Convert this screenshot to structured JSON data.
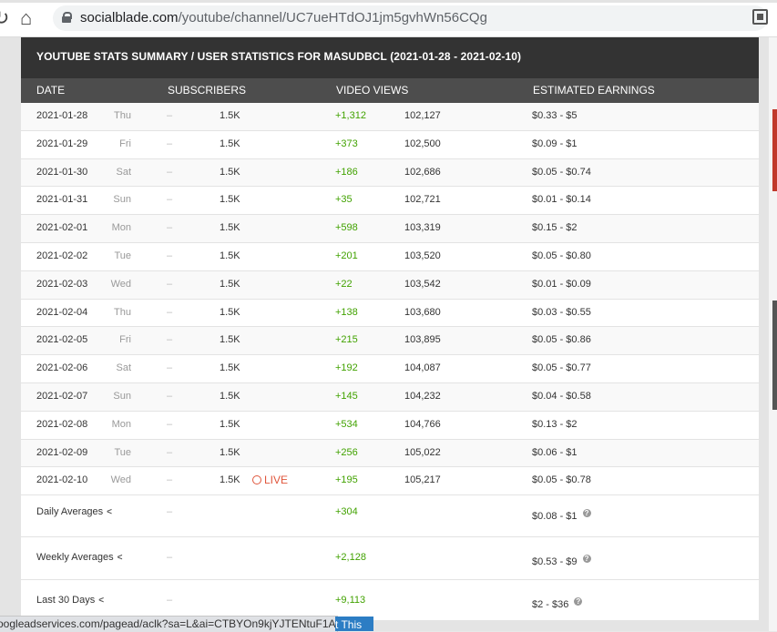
{
  "browser": {
    "url_host": "socialblade.com",
    "url_path": "/youtube/channel/UC7ueHTdOJ1jm5gvhWn56CQg",
    "status_url": "oogleadservices.com/pagead/aclk?sa=L&ai=CTBYOn9kjYJTENtuF1A...",
    "overlay_button": "t This"
  },
  "panel": {
    "title": "YOUTUBE STATS SUMMARY / USER STATISTICS FOR MASUDBCL (2021-01-28 - 2021-02-10)",
    "columns": {
      "date": "DATE",
      "subscribers": "SUBSCRIBERS",
      "video_views": "VIDEO VIEWS",
      "earnings": "ESTIMATED EARNINGS"
    },
    "rows": [
      {
        "date": "2021-01-28",
        "dow": "Thu",
        "dash": "–",
        "subs": "1.5K",
        "views_delta": "+1,312",
        "views": "102,127",
        "earnings": "$0.33  -  $5"
      },
      {
        "date": "2021-01-29",
        "dow": "Fri",
        "dash": "–",
        "subs": "1.5K",
        "views_delta": "+373",
        "views": "102,500",
        "earnings": "$0.09  -  $1"
      },
      {
        "date": "2021-01-30",
        "dow": "Sat",
        "dash": "–",
        "subs": "1.5K",
        "views_delta": "+186",
        "views": "102,686",
        "earnings": "$0.05  -  $0.74"
      },
      {
        "date": "2021-01-31",
        "dow": "Sun",
        "dash": "–",
        "subs": "1.5K",
        "views_delta": "+35",
        "views": "102,721",
        "earnings": "$0.01  -  $0.14"
      },
      {
        "date": "2021-02-01",
        "dow": "Mon",
        "dash": "–",
        "subs": "1.5K",
        "views_delta": "+598",
        "views": "103,319",
        "earnings": "$0.15  -  $2"
      },
      {
        "date": "2021-02-02",
        "dow": "Tue",
        "dash": "–",
        "subs": "1.5K",
        "views_delta": "+201",
        "views": "103,520",
        "earnings": "$0.05  -  $0.80"
      },
      {
        "date": "2021-02-03",
        "dow": "Wed",
        "dash": "–",
        "subs": "1.5K",
        "views_delta": "+22",
        "views": "103,542",
        "earnings": "$0.01  -  $0.09"
      },
      {
        "date": "2021-02-04",
        "dow": "Thu",
        "dash": "–",
        "subs": "1.5K",
        "views_delta": "+138",
        "views": "103,680",
        "earnings": "$0.03  -  $0.55"
      },
      {
        "date": "2021-02-05",
        "dow": "Fri",
        "dash": "–",
        "subs": "1.5K",
        "views_delta": "+215",
        "views": "103,895",
        "earnings": "$0.05  -  $0.86"
      },
      {
        "date": "2021-02-06",
        "dow": "Sat",
        "dash": "–",
        "subs": "1.5K",
        "views_delta": "+192",
        "views": "104,087",
        "earnings": "$0.05  -  $0.77"
      },
      {
        "date": "2021-02-07",
        "dow": "Sun",
        "dash": "–",
        "subs": "1.5K",
        "views_delta": "+145",
        "views": "104,232",
        "earnings": "$0.04  -  $0.58"
      },
      {
        "date": "2021-02-08",
        "dow": "Mon",
        "dash": "–",
        "subs": "1.5K",
        "views_delta": "+534",
        "views": "104,766",
        "earnings": "$0.13  -  $2"
      },
      {
        "date": "2021-02-09",
        "dow": "Tue",
        "dash": "–",
        "subs": "1.5K",
        "views_delta": "+256",
        "views": "105,022",
        "earnings": "$0.06  -  $1"
      },
      {
        "date": "2021-02-10",
        "dow": "Wed",
        "dash": "–",
        "subs": "1.5K",
        "views_delta": "+195",
        "views": "105,217",
        "earnings": "$0.05  -  $0.78"
      }
    ],
    "live_label": "LIVE",
    "averages": [
      {
        "label": "Daily Averages",
        "dash": "–",
        "views": "+304",
        "earnings": "$0.08  -  $1"
      },
      {
        "label": "Weekly Averages",
        "dash": "–",
        "views": "+2,128",
        "earnings": "$0.53  -  $9"
      },
      {
        "label": "Last 30 Days",
        "dash": "–",
        "views": "+9,113",
        "earnings": "$2  -  $36"
      }
    ]
  }
}
